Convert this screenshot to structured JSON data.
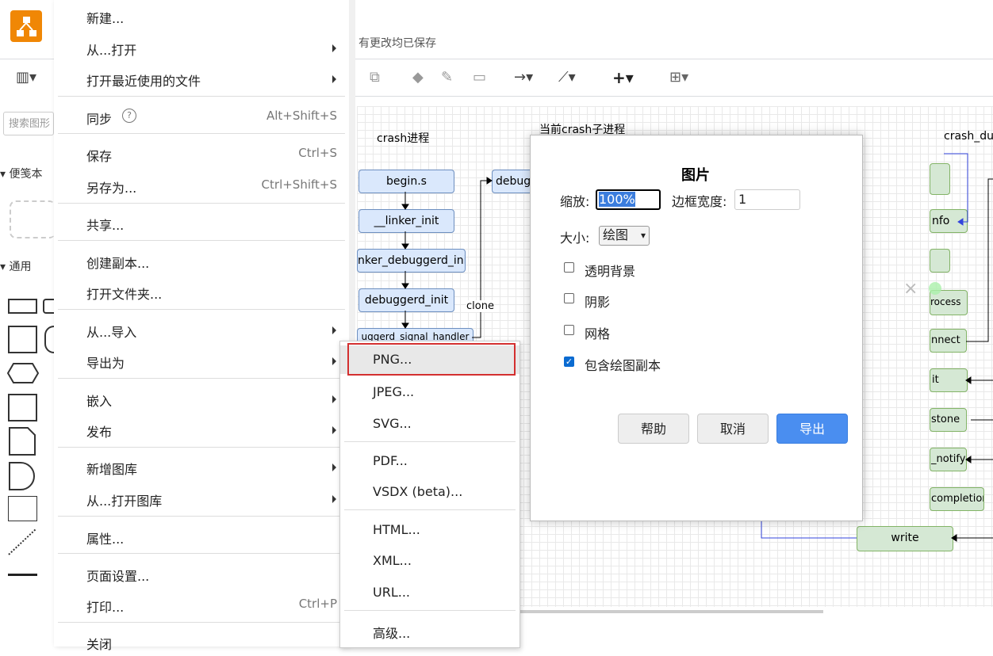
{
  "app": {
    "status_text": "有更改均已保存",
    "search_placeholder": "搜索图形"
  },
  "sidebar": {
    "section_notes": "便笺本",
    "section_general": "通用"
  },
  "canvas": {
    "lane_titles": [
      "crash进程",
      "当前crash子进程",
      "crash_du"
    ],
    "blue_nodes": [
      "begin.s",
      "__linker_init",
      "nker_debuggerd_init",
      "debuggerd_init",
      "uggerd_signal_handler",
      "debug"
    ],
    "green_nodes": [
      "nfo",
      "rocess",
      "nnect",
      "it",
      "stone",
      "_notify",
      "completion",
      "write"
    ],
    "edge_label": "clone"
  },
  "menu": {
    "items": [
      {
        "label": "新建...",
        "shortcut": "",
        "arrow": false
      },
      {
        "label": "从...打开",
        "shortcut": "",
        "arrow": true
      },
      {
        "label": "打开最近使用的文件",
        "shortcut": "",
        "arrow": true
      },
      {
        "label": "同步",
        "shortcut": "Alt+Shift+S",
        "arrow": false
      },
      {
        "label": "保存",
        "shortcut": "Ctrl+S",
        "arrow": false
      },
      {
        "label": "另存为...",
        "shortcut": "Ctrl+Shift+S",
        "arrow": false
      },
      {
        "label": "共享...",
        "shortcut": "",
        "arrow": false
      },
      {
        "label": "创建副本...",
        "shortcut": "",
        "arrow": false
      },
      {
        "label": "打开文件夹...",
        "shortcut": "",
        "arrow": false
      },
      {
        "label": "从...导入",
        "shortcut": "",
        "arrow": true
      },
      {
        "label": "导出为",
        "shortcut": "",
        "arrow": true
      },
      {
        "label": "嵌入",
        "shortcut": "",
        "arrow": true
      },
      {
        "label": "发布",
        "shortcut": "",
        "arrow": true
      },
      {
        "label": "新增图库",
        "shortcut": "",
        "arrow": true
      },
      {
        "label": "从...打开图库",
        "shortcut": "",
        "arrow": true
      },
      {
        "label": "属性...",
        "shortcut": "",
        "arrow": false
      },
      {
        "label": "页面设置...",
        "shortcut": "",
        "arrow": false
      },
      {
        "label": "打印...",
        "shortcut": "Ctrl+P",
        "arrow": false
      },
      {
        "label": "关闭",
        "shortcut": "",
        "arrow": false
      }
    ]
  },
  "export_submenu": {
    "items": [
      "PNG...",
      "JPEG...",
      "SVG...",
      "PDF...",
      "VSDX (beta)...",
      "HTML...",
      "XML...",
      "URL...",
      "高级..."
    ]
  },
  "dialog": {
    "title": "图片",
    "zoom_label": "缩放:",
    "zoom_value": "100%",
    "border_label": "边框宽度:",
    "border_value": "1",
    "size_label": "大小:",
    "size_value": "绘图",
    "options": [
      {
        "label": "透明背景",
        "checked": false
      },
      {
        "label": "阴影",
        "checked": false
      },
      {
        "label": "网格",
        "checked": false
      },
      {
        "label": "包含绘图副本",
        "checked": true
      }
    ],
    "help_button": "帮助",
    "cancel_button": "取消",
    "export_button": "导出",
    "close_symbol": "×"
  },
  "colors": {
    "accent": "#4a8ef0",
    "logo": "#f08705",
    "highlight_border": "#d32f2f"
  }
}
